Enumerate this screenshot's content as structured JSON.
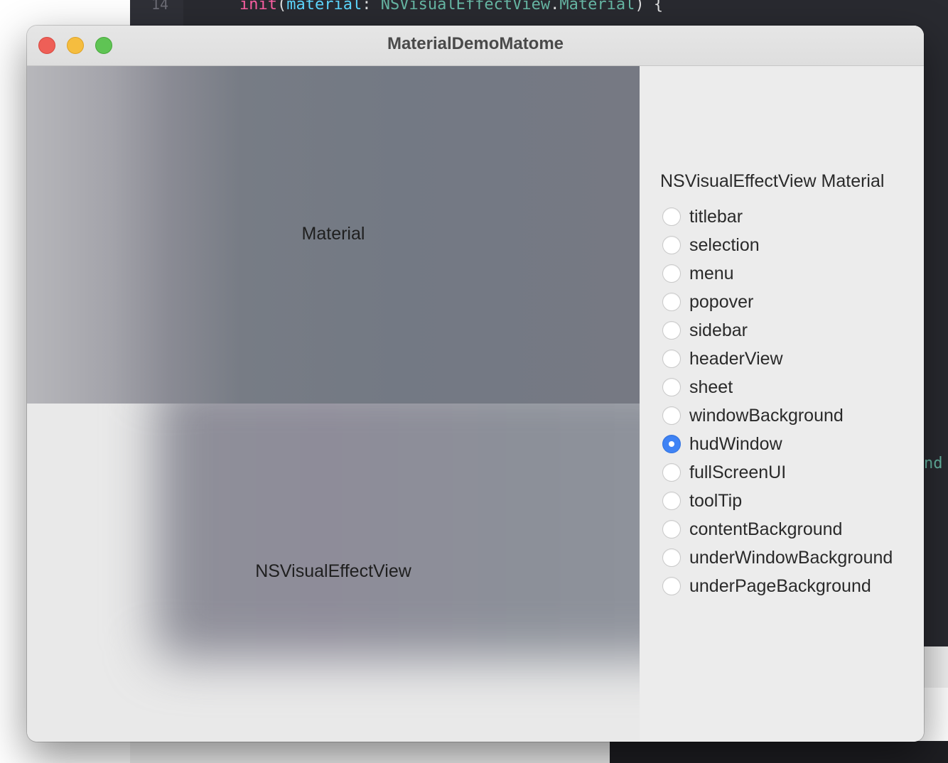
{
  "background": {
    "line_number": "14",
    "code": {
      "keyword": "init",
      "open_paren": "(",
      "param": "material",
      "colon": ": ",
      "type_name": "NSVisualEffectView",
      "dot": ".",
      "member": "Material",
      "closing": ") {"
    },
    "right_fragment": "nd"
  },
  "window": {
    "title": "MaterialDemoMatome"
  },
  "main": {
    "material_label": "Material",
    "effect_view_label": "NSVisualEffectView"
  },
  "sidebar": {
    "title": "NSVisualEffectView Material",
    "options": [
      {
        "label": "titlebar",
        "selected": false
      },
      {
        "label": "selection",
        "selected": false
      },
      {
        "label": "menu",
        "selected": false
      },
      {
        "label": "popover",
        "selected": false
      },
      {
        "label": "sidebar",
        "selected": false
      },
      {
        "label": "headerView",
        "selected": false
      },
      {
        "label": "sheet",
        "selected": false
      },
      {
        "label": "windowBackground",
        "selected": false
      },
      {
        "label": "hudWindow",
        "selected": true
      },
      {
        "label": "fullScreenUI",
        "selected": false
      },
      {
        "label": "toolTip",
        "selected": false
      },
      {
        "label": "contentBackground",
        "selected": false
      },
      {
        "label": "underWindowBackground",
        "selected": false
      },
      {
        "label": "underPageBackground",
        "selected": false
      }
    ],
    "accent_color": "#3f83f5"
  }
}
